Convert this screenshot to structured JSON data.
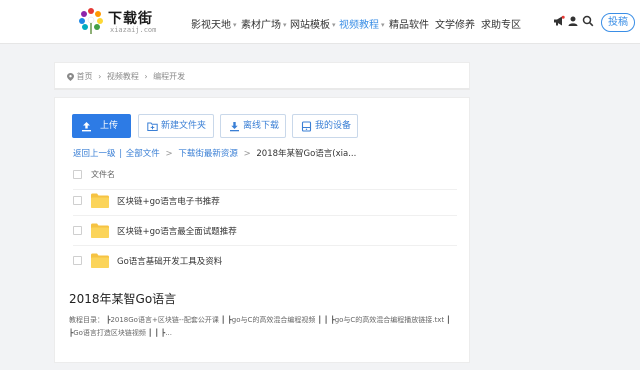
{
  "header": {
    "logo_title": "下载街",
    "logo_sub": "xiazaij.com",
    "nav": [
      {
        "label": "影视天地",
        "caret": "▾",
        "active": false
      },
      {
        "label": "素材广场",
        "caret": "▾",
        "active": false
      },
      {
        "label": "网站模板",
        "caret": "▾",
        "active": false
      },
      {
        "label": "视频教程",
        "caret": "▾",
        "active": true
      },
      {
        "label": "精品软件",
        "caret": "",
        "active": false
      },
      {
        "label": "文学修养",
        "caret": "",
        "active": false
      },
      {
        "label": "求助专区",
        "caret": "",
        "active": false
      }
    ],
    "icons": [
      "megaphone-icon",
      "user-icon",
      "search-icon"
    ],
    "post_label": "投稿",
    "accent_color": "#3a8ee6"
  },
  "breadcrumb": {
    "home": "首页",
    "level1": "视频教程",
    "level2": "编程开发",
    "separator": "›"
  },
  "toolbar": {
    "upload": "上传",
    "new_folder": "新建文件夹",
    "offline_download": "离线下载",
    "my_devices": "我的设备"
  },
  "path": {
    "back": "返回上一级",
    "divider": "|",
    "all_files": "全部文件",
    "sep": ">",
    "folder": "下载街最新资源",
    "current": "2018年某智Go语言(xia..."
  },
  "files": {
    "column_header": "文件名",
    "items": [
      {
        "name": "区块链+go语言电子书推荐"
      },
      {
        "name": "区块链+go语言最全面试题推荐"
      },
      {
        "name": "Go语言基础开发工具及资料"
      }
    ]
  },
  "post": {
    "title": "2018年某智Go语言",
    "description": "教程目录： ┣2018Go语言+区块链--配套公开课 ┃ ┣go与C的高效混合编程视频 ┃ ┃ ┣go与C的高效混合编程播放链接.txt ┃ ┣Go语言打造区块链视频 ┃ ┃ ┣..."
  },
  "colors": {
    "primary_button": "#2d7be5",
    "folder": "#f6c343",
    "page_bg": "#f2f3f5"
  }
}
